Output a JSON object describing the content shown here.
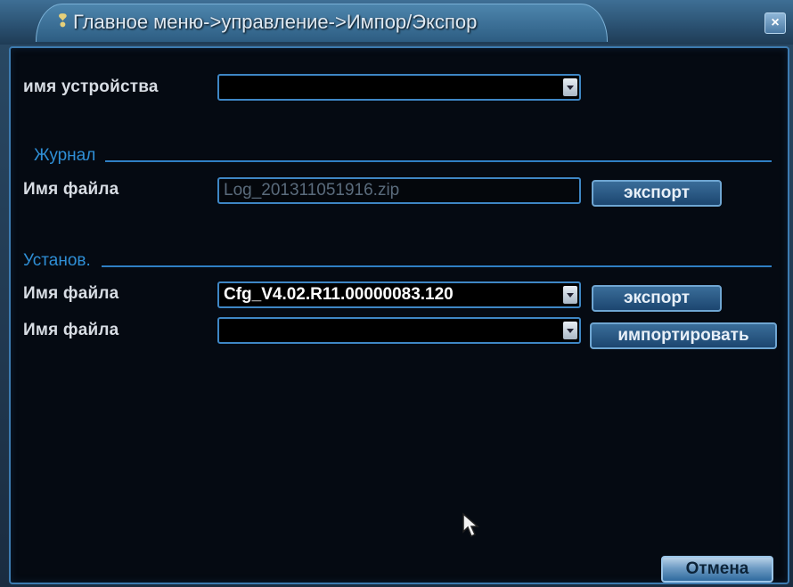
{
  "window": {
    "title": "Главное меню->управление->Импор/Экспор",
    "close_label": "×"
  },
  "device": {
    "label": "имя устройства",
    "value": ""
  },
  "journal": {
    "section_label": "Журнал",
    "file_label": "Имя файла",
    "file_value": "Log_201311051916.zip",
    "export_label": "экспорт"
  },
  "settings": {
    "section_label": "Установ.",
    "export_file_label": "Имя файла",
    "export_file_value": "Cfg_V4.02.R11.00000083.120",
    "export_label": "экспорт",
    "import_file_label": "Имя файла",
    "import_file_value": "",
    "import_label": "импортировать"
  },
  "footer": {
    "cancel_label": "Отмена"
  },
  "colors": {
    "accent": "#3e86c4",
    "section": "#2f8fd6",
    "panel_bg": "#050a12"
  }
}
